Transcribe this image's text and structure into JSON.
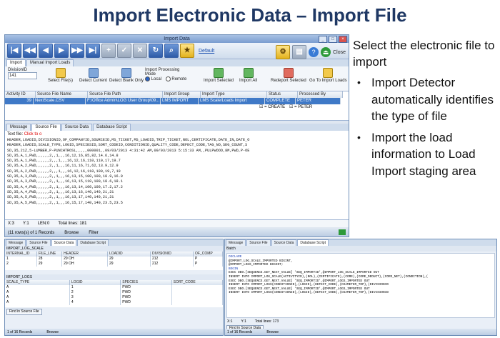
{
  "slide": {
    "title": "Import Electronic Data – Import File",
    "lead": "Select the electronic file to import",
    "bullets": [
      "Import Detector automatically identifies the type of file",
      "Import the load information to Load Import staging area"
    ]
  },
  "window": {
    "title": "Import Data",
    "default_link": "Default",
    "close_label": "Close",
    "tabs": [
      "Import",
      "Manual Import Loads"
    ],
    "ribbon": {
      "division_label": "DivisionID",
      "division_value": "141",
      "buttons": [
        "Select File(s)",
        "Detect Current",
        "Detect Blank Only",
        "Import Selected",
        "Import All",
        "Redeport Selected",
        "Go To Import Loads"
      ],
      "mode_label": "Import Processing Mode",
      "mode_local": "Local",
      "mode_remote": "Remote"
    },
    "grid": {
      "columns": [
        "Activity ID",
        "Source File Name",
        "Source File Path",
        "Import Group",
        "Import Type",
        "Status",
        "Processed By"
      ],
      "row": [
        "39",
        "NextScale.CSV",
        "F:\\Office Admin\\LOG User Group\\09...",
        "LMS IMPORT",
        "LMS Scale/Loads Import",
        "COMPLETE",
        "PETER"
      ],
      "row_sub": [
        "☑ = CREATE",
        "☑ = PETER"
      ]
    },
    "lower_tabs": [
      "Message",
      "Source File",
      "Source Data",
      "Database Script"
    ],
    "file_label": "Text file:",
    "file_click": "Click to o",
    "text_lines": [
      "HEADER,LOADID,DIVISIONID,OF_COMPANYID,SOURCEID,MS_TICKET,MS_LOADID,TRIP_TICKET,NOL,CERTIFICATE,DATE_IN,DATE_O",
      "HEADER,LOADID,SCALE_TYPE,LOGID,SPECIESID,SORT_CODEID,CONDITIONID,QUALITY_CODE,DEFECT_CODE,TAG_NO,SEG_COUNT,S",
      "SD,35,21Z,5-LUMBER,P-PUNCHTROSL,,,,,000001,,09/03/2013 4:31:42 AM,09/03/2013 5:15:33 AM,,PULPWOOD,8M,PWD,P-OE",
      "SD,35,A,1,PWD,,,,,,2,,1,,,16,12,16,85,82,14.6,14.8",
      "SD,35,A,1,PWD,,,,,,2,,,1,,,16,12,16,110,110,17,19.7",
      "SD,35,A,2,PWD,,,,,,2,,1,,,16,11,16,71,62,13.9,12.9",
      "SD,35,A,2,PWD,,,,,,2,,,1,,,16,12,16,110,100,19,7,19",
      "SD,35,A,3,PWD,,,,,,2,,1,,,16,13,15,100,100,18.9,16.9",
      "SD,35,A,3,PWD,,,,,,2,,1,,,16,13,15,110,100,18.6,18.1",
      "SD,35,A,4,PWD,,,,,,2,,1,,,16,13,14,100,100,17.2,17.2",
      "SD,35,A,4,PWD,,,,,,2,,1,,,16,13,16,140,140,21,21",
      "SD,35,A,5,PWD,,,,,,2,,1,,,16,13,17,140,140,21,21",
      "SD,35,A,5,PWD,,,,,,2,,1,,,16,15,17,140,140,23.5,23.5"
    ],
    "info": {
      "col1": "X:3",
      "col2": "Y:1",
      "col3": "LEN:0",
      "total": "Total lines: 181"
    },
    "status": {
      "records": "(11 rows(s) of 1 Records",
      "browse": "Browse",
      "filter": "Filter"
    }
  },
  "bottom_left": {
    "tabs": [
      "Message",
      "Source File",
      "Source Data",
      "Database Script"
    ],
    "section1": "IMPORT_LOG_SCALE",
    "grid1_cols": [
      "INTERNAL_ID",
      "FILE_LINE",
      "HEADER",
      "LOADID",
      "DIVISIONID",
      "OF_COMP"
    ],
    "grid1_rows": [
      [
        "1",
        "28",
        "29 OH",
        "29",
        "212",
        "P"
      ],
      [
        "2",
        "29",
        "29 OH",
        "29",
        "212",
        "P"
      ]
    ],
    "section2": "IMPORT_LOGS",
    "grid2_cols": [
      "SCALE_TYPE",
      "LOGID",
      "SPECIES",
      "SORT_CODE"
    ],
    "grid2_rows": [
      [
        "A",
        "1",
        "PWD",
        ""
      ],
      [
        "A",
        "2",
        "PWD",
        ""
      ],
      [
        "A",
        "3",
        "PWD",
        ""
      ],
      [
        "A",
        "4",
        "PWD",
        ""
      ]
    ],
    "find_button": "Find in Source File",
    "status": {
      "records": "1 of 16 Records",
      "browse": "Browse"
    }
  },
  "bottom_right": {
    "tabs": [
      "Message",
      "Source File",
      "Source Data",
      "Database Script"
    ],
    "subtab": "Batch",
    "sql_lines": [
      "DECLARE",
      "  @IMPORT_LOG_SCALE_IMPORTED BIGINT,",
      "  @IMPORT_LOGS_IMPORTED BIGINT;",
      "BEGIN",
      "  EXEC DBO.[SEQUENCE.GET_NEXT_VALUE] 'SEQ_IMPORTID',@IMPORT_LOG_SCALE_IMPORTED OUT",
      "  INSERT INTO IMPORT_LOG_SCALE(ACTIVITYID),(NOL),(CERTIFICATE),(CORE),(CORE_DEDUCT),(CORE_NET),(CONDITION),(",
      "    EXEC DBO.[SEQUENCE.GET_NEXT_VALUE] 'SEQ_IMPORTID',@IMPORT_LOGS_IMPORTED OUT",
      "    INSERT INTO IMPORT_LOGS(CONDITIONID),(LOGID),(DEFECT_CODE),(DIAMETER_TOP),(DIVISIONID",
      "    EXEC DBO.[SEQUENCE.GET_NEXT_VALUE] 'SEQ_IMPORTID',@IMPORT_LOGS_IMPORTED OUT",
      "    INSERT INTO IMPORT_LOGS(CONDITIONID),(LOGID),(DEFECT_CODE),(DIAMETER_TOP),(DIVISIONID"
    ],
    "info": {
      "col1": "X:1",
      "col2": "Y:1",
      "total": "Total lines: 173"
    },
    "find_button": "Find in Source Data",
    "status": {
      "records": "1 of 16 Records",
      "browse": "Browse"
    }
  }
}
